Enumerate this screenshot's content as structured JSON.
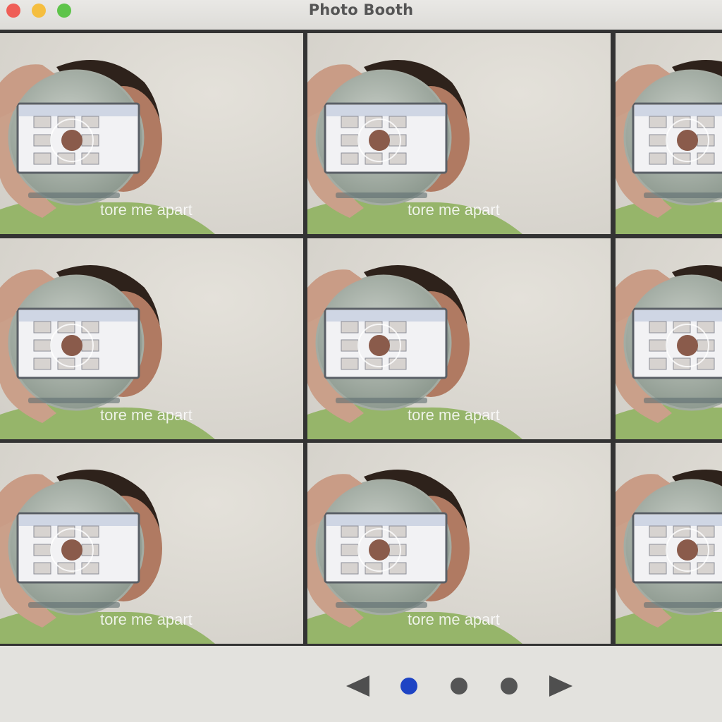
{
  "window": {
    "title": "Photo Booth"
  },
  "controls": {
    "close_color": "#ef5e57",
    "minimize_color": "#f5be3f",
    "zoom_color": "#5ec44a"
  },
  "grid": {
    "rows": 3,
    "columns_visible": 3,
    "photos": [
      {
        "caption": "tore me apart"
      },
      {
        "caption": "tore me apart"
      },
      {
        "caption": "tore me apart"
      },
      {
        "caption": "tore me apart"
      },
      {
        "caption": "tore me apart"
      },
      {
        "caption": "tore me apart"
      },
      {
        "caption": "tore me apart"
      },
      {
        "caption": "tore me apart"
      },
      {
        "caption": "tore me apart"
      }
    ]
  },
  "pagination": {
    "pages": 3,
    "current_page": 1,
    "active_color": "#1e44c4",
    "inactive_color": "#555555",
    "prev_icon": "triangle-left-icon",
    "next_icon": "triangle-right-icon"
  }
}
